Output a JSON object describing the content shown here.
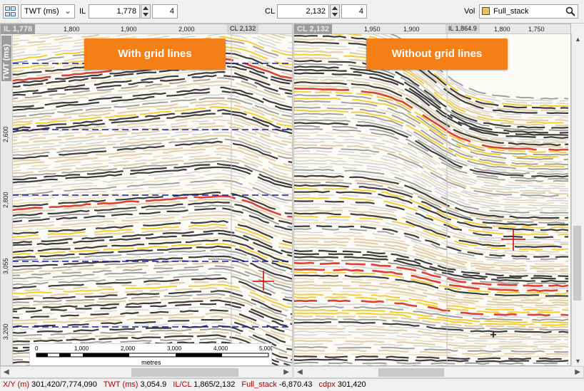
{
  "toolbar": {
    "domain_select": "TWT (ms)",
    "il_label": "IL",
    "il_value": "1,778",
    "il_step": "4",
    "cl_label": "CL",
    "cl_value": "2,132",
    "cl_step": "4",
    "vol_label": "Vol",
    "vol_value": "Full_stack"
  },
  "left_panel": {
    "section_title": "IL 1,778",
    "cross_tag": "CL 2,132",
    "top_ticks": [
      "1,800",
      "1,900",
      "2,000"
    ],
    "axis_title": "TWT (ms)",
    "side_ticks": [
      "2,600",
      "2,800",
      "3,055",
      "3,200"
    ],
    "callout": "With grid lines",
    "scale": {
      "ticks": [
        "0",
        "1,000",
        "2,000",
        "3,000",
        "4,000",
        "5,000"
      ],
      "unit": "metres"
    }
  },
  "right_panel": {
    "section_title": "CL 2,132",
    "cross_tag": "IL 1,864.9",
    "top_ticks": [
      "1,950",
      "1,900",
      "1,800",
      "1,750"
    ],
    "callout": "Without grid lines"
  },
  "status": {
    "xy_label": "X/Y (m)",
    "xy_value": "301,420/7,774,090",
    "twt_label": "TWT (ms)",
    "twt_value": "3,054.9",
    "ilcl_label": "IL/CL",
    "ilcl_value": "1,865/2,132",
    "vol_label": "Full_stack",
    "vol_value": "-6,870.43",
    "cdpx_label": "cdpx",
    "cdpx_value": "301,420"
  },
  "colors": {
    "accent": "#f57f17",
    "gridline": "#1a1aa8",
    "cursor": "#d00000"
  }
}
